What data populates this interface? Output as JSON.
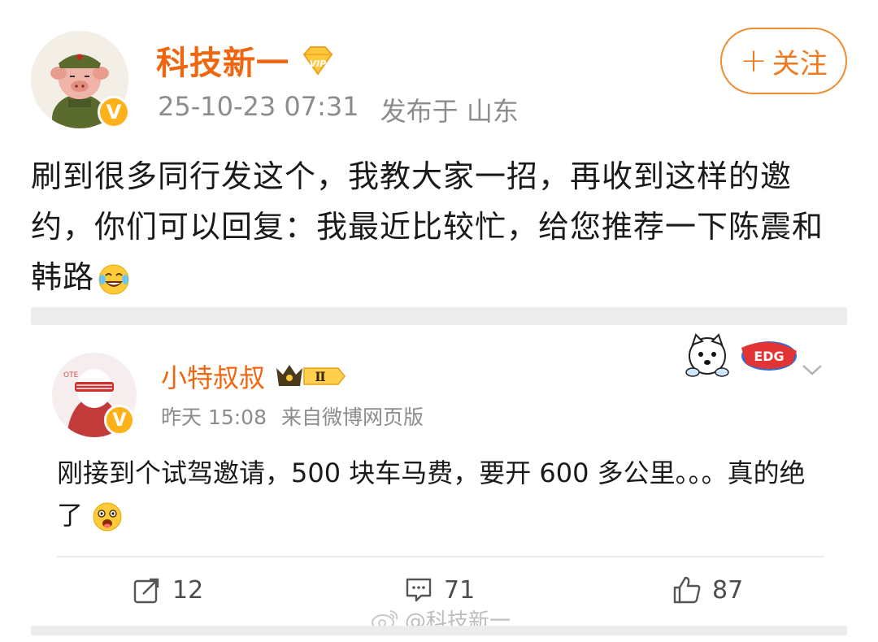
{
  "post": {
    "author": "科技新一",
    "timestamp": "25-10-23 07:31",
    "location": "发布于 山东",
    "follow_label": "关注",
    "follow_plus": "+",
    "text": "刷到很多同行发这个，我教大家一招，再收到这样的邀约，你们可以回复：我最近比较忙，给您推荐一下陈震和韩路",
    "emoji": "laugh-cry-emoji",
    "vip_badge": "VIP",
    "verified_badge": "V"
  },
  "quoted": {
    "author": "小特叔叔",
    "rank_badge": "Ⅱ",
    "timestamp": "昨天 15:08",
    "source": "来自微博网页版",
    "text": "刚接到个试驾邀请，500 块车马费，要开 600 多公里。。。真的绝了",
    "emoji": "shocked-emoji",
    "verified_badge": "V",
    "sticker_text": "EDG"
  },
  "actions": {
    "repost_count": "12",
    "comment_count": "71",
    "like_count": "87"
  },
  "watermark": "@科技新一",
  "colors": {
    "accent": "#f0660f",
    "verified": "#ffb11a",
    "meta_text": "#8c8c8c"
  }
}
